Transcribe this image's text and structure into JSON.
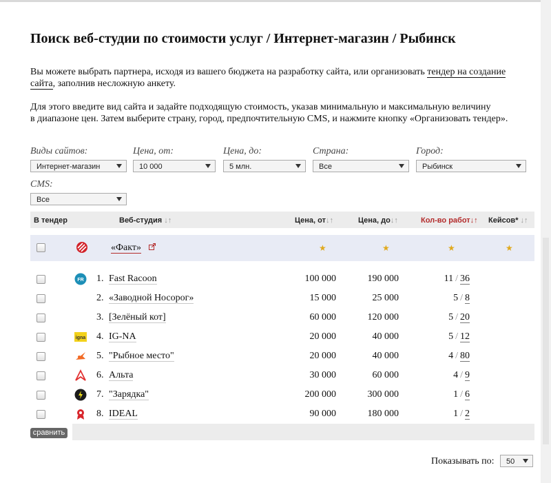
{
  "title": "Поиск веб-студии по стоимости услуг / Интернет-магазин / Рыбинск",
  "intro": {
    "text_before": "Вы можете выбрать партнера, исходя из вашего бюджета на разработку сайта, или организовать ",
    "link1": "тендер на создание",
    "link2": "сайта",
    "text_after": ", заполнив несложную анкету."
  },
  "instructions_line1": "Для этого введите вид сайта и задайте подходящую стоимость, указав минимальную и максимальную величину",
  "instructions_line2": "в диапазоне цен. Затем выберите страну, город, предпочтительную CMS, и нажмите кнопку «Организовать тендер».",
  "filters": {
    "site_type": {
      "label": "Виды сайтов:",
      "value": "Интернет-магазин"
    },
    "price_from": {
      "label": "Цена, от:",
      "value": "10 000"
    },
    "price_to": {
      "label": "Цена, до:",
      "value": "5 млн."
    },
    "country": {
      "label": "Страна:",
      "value": "Все"
    },
    "city": {
      "label": "Город:",
      "value": "Рыбинск"
    },
    "cms": {
      "label": "CMS:",
      "value": "Все"
    }
  },
  "table_headers": {
    "tender": "В тендер",
    "studio": "Веб-студия",
    "price_from": "Цена, от",
    "price_to": "Цена, до",
    "works": "Кол-во работ",
    "cases": "Кейсов*",
    "sort": "↓↑"
  },
  "featured": {
    "name": "«Факт»",
    "star": "★"
  },
  "rows": [
    {
      "num": "1.",
      "name": "Fast Racoon",
      "price_from": "100 000",
      "price_to": "190 000",
      "works": "11",
      "cases": "36",
      "icon": "fast-racoon-logo"
    },
    {
      "num": "2.",
      "name": "«Заводной Носорог»",
      "price_from": "15 000",
      "price_to": "25 000",
      "works": "5",
      "cases": "8",
      "icon": ""
    },
    {
      "num": "3.",
      "name": "[Зелёный кот]",
      "price_from": "60 000",
      "price_to": "120 000",
      "works": "5",
      "cases": "20",
      "icon": ""
    },
    {
      "num": "4.",
      "name": "IG-NA",
      "price_from": "20 000",
      "price_to": "40 000",
      "works": "5",
      "cases": "12",
      "icon": "igna-logo"
    },
    {
      "num": "5.",
      "name": "\"Рыбное место\"",
      "price_from": "20 000",
      "price_to": "40 000",
      "works": "4",
      "cases": "80",
      "icon": "rybnoe-mesto-logo"
    },
    {
      "num": "6.",
      "name": "Альта",
      "price_from": "30 000",
      "price_to": "60 000",
      "works": "4",
      "cases": "9",
      "icon": "alta-logo"
    },
    {
      "num": "7.",
      "name": "\"Зарядка\"",
      "price_from": "200 000",
      "price_to": "300 000",
      "works": "1",
      "cases": "6",
      "icon": "zaryadka-logo"
    },
    {
      "num": "8.",
      "name": "IDEAL",
      "price_from": "90 000",
      "price_to": "180 000",
      "works": "1",
      "cases": "2",
      "icon": "ideal-logo"
    }
  ],
  "works_separator": "/",
  "compare_button": "сравнить",
  "pager": {
    "label": "Показывать по:",
    "value": "50"
  },
  "colors": {
    "accent_red": "#b32a2a",
    "featured_bg": "#e8ebf5",
    "star": "#e0a91d"
  }
}
